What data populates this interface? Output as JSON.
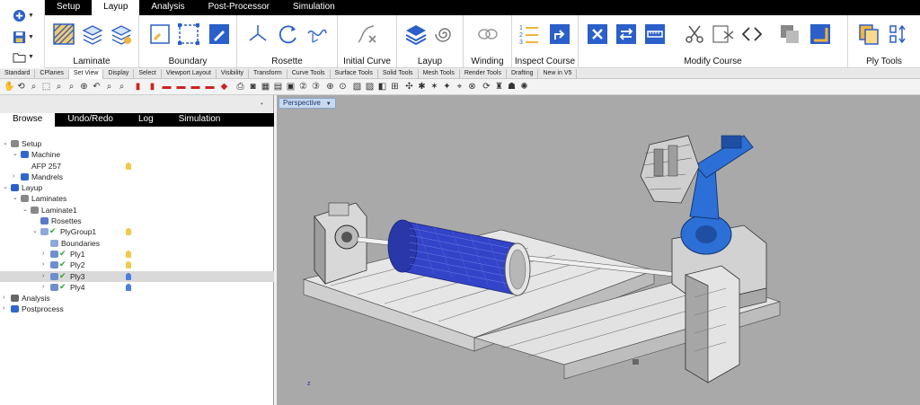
{
  "menu": {
    "tabs": [
      "Setup",
      "Layup",
      "Analysis",
      "Post-Processor",
      "Simulation"
    ],
    "active": "Layup"
  },
  "ribbon": {
    "groups": [
      "Laminate",
      "Boundary",
      "Rosette",
      "Initial Curve",
      "Layup",
      "Winding",
      "Inspect Course",
      "Modify Course",
      "Ply Tools"
    ]
  },
  "toolbar_tabs": {
    "items": [
      "Standard",
      "CPlanes",
      "Set View",
      "Display",
      "Select",
      "Viewport Layout",
      "Visibility",
      "Transform",
      "Curve Tools",
      "Surface Tools",
      "Solid Tools",
      "Mesh Tools",
      "Render Tools",
      "Drafting",
      "New in V5"
    ],
    "active": "Set View"
  },
  "panel": {
    "tabs": [
      "Browse",
      "Undo/Redo",
      "Log",
      "Simulation"
    ],
    "active": "Browse"
  },
  "tree": [
    {
      "label": "Setup",
      "depth": 0,
      "expanded": true,
      "icon": "gear-icon"
    },
    {
      "label": "Machine",
      "depth": 1,
      "expanded": true,
      "icon": "robot-icon"
    },
    {
      "label": "AFP 257",
      "depth": 2,
      "icon": "none",
      "bulb": "yellow"
    },
    {
      "label": "Mandrels",
      "depth": 1,
      "expanded": false,
      "icon": "mandrel-icon"
    },
    {
      "label": "Layup",
      "depth": 0,
      "expanded": true,
      "icon": "layers-icon"
    },
    {
      "label": "Laminates",
      "depth": 1,
      "expanded": true,
      "icon": "laminates-icon"
    },
    {
      "label": "Laminate1",
      "depth": 2,
      "expanded": true,
      "icon": "laminate-icon"
    },
    {
      "label": "Rosettes",
      "depth": 3,
      "icon": "rosette-icon"
    },
    {
      "label": "PlyGroup1",
      "depth": 3,
      "expanded": true,
      "icon": "plygroup-icon",
      "bulb": "yellow"
    },
    {
      "label": "Boundaries",
      "depth": 4,
      "icon": "boundary-icon"
    },
    {
      "label": "Ply1",
      "depth": 4,
      "expanded": false,
      "icon": "ply-icon",
      "bulb": "yellow"
    },
    {
      "label": "Ply2",
      "depth": 4,
      "expanded": false,
      "icon": "ply-icon",
      "bulb": "yellow"
    },
    {
      "label": "Ply3",
      "depth": 4,
      "expanded": false,
      "icon": "ply-icon",
      "bulb": "blue",
      "selected": true
    },
    {
      "label": "Ply4",
      "depth": 4,
      "expanded": false,
      "icon": "ply-icon",
      "bulb": "blue"
    },
    {
      "label": "Analysis",
      "depth": 0,
      "expanded": false,
      "icon": "analysis-icon"
    },
    {
      "label": "Postprocess",
      "depth": 0,
      "expanded": false,
      "icon": "postprocess-icon"
    }
  ],
  "viewport": {
    "title": "Perspective",
    "axis_label": "z"
  },
  "colors": {
    "menubar": "#000000",
    "mandrel": "#3344c8",
    "robot": "#2c6fd6",
    "viewport_bg": "#a9a9a9",
    "bulb_yellow": "#f2c94c",
    "bulb_blue": "#4a7fe0",
    "check_green": "#27a327"
  }
}
